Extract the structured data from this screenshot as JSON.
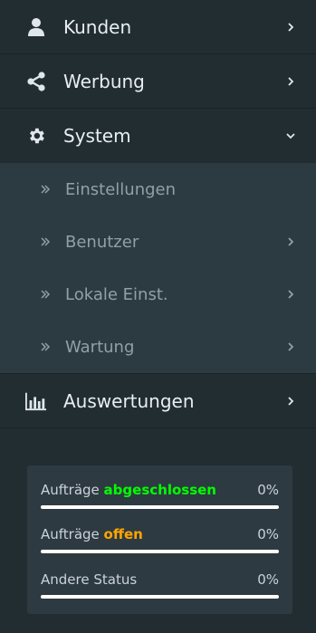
{
  "menu": {
    "kunden": {
      "label": "Kunden",
      "icon": "user-icon"
    },
    "werbung": {
      "label": "Werbung",
      "icon": "share-icon"
    },
    "system": {
      "label": "System",
      "icon": "gear-icon",
      "items": [
        {
          "label": "Einstellungen"
        },
        {
          "label": "Benutzer"
        },
        {
          "label": "Lokale Einst."
        },
        {
          "label": "Wartung"
        }
      ]
    },
    "auswertungen": {
      "label": "Auswertungen",
      "icon": "bar-chart-icon"
    }
  },
  "stats": {
    "completed": {
      "prefix": "Aufträge ",
      "highlight": "abgeschlossen",
      "value": "0%"
    },
    "open": {
      "prefix": "Aufträge ",
      "highlight": "offen",
      "value": "0%"
    },
    "other": {
      "label": "Andere Status",
      "value": "0%"
    }
  },
  "colors": {
    "sidebar": "#222d32",
    "submenu": "#2c3b41",
    "completed": "#00ff00",
    "open": "#ffa500"
  }
}
